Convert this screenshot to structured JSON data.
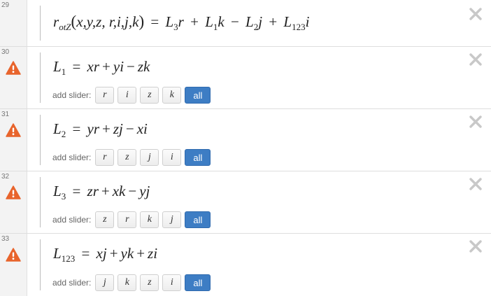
{
  "expressions": [
    {
      "line": "29",
      "warning": false,
      "math": {
        "fn_base": "r",
        "fn_sub": "otZ",
        "fn_args": "x,y,z, r,i,j,k",
        "t1": "L",
        "t1_sub": "3",
        "t1_var": "r",
        "op1": "+",
        "t2": "L",
        "t2_sub": "1",
        "t2_var": "k",
        "op2": "−",
        "t3": "L",
        "t3_sub": "2",
        "t3_var": "j",
        "op3": "+",
        "t4": "L",
        "t4_sub": "123",
        "t4_var": "i"
      }
    },
    {
      "line": "30",
      "warning": true,
      "lhs": "L",
      "lhs_sub": "1",
      "terms": [
        "xr",
        "+",
        "yi",
        "−",
        "zk"
      ],
      "slider_label": "add slider:",
      "sliders": [
        "r",
        "i",
        "z",
        "k"
      ],
      "all_label": "all"
    },
    {
      "line": "31",
      "warning": true,
      "lhs": "L",
      "lhs_sub": "2",
      "terms": [
        "yr",
        "+",
        "zj",
        "−",
        "xi"
      ],
      "slider_label": "add slider:",
      "sliders": [
        "r",
        "z",
        "j",
        "i"
      ],
      "all_label": "all"
    },
    {
      "line": "32",
      "warning": true,
      "lhs": "L",
      "lhs_sub": "3",
      "terms": [
        "zr",
        "+",
        "xk",
        "−",
        "yj"
      ],
      "slider_label": "add slider:",
      "sliders": [
        "z",
        "r",
        "k",
        "j"
      ],
      "all_label": "all"
    },
    {
      "line": "33",
      "warning": true,
      "lhs": "L",
      "lhs_sub": "123",
      "terms": [
        "xj",
        "+",
        "yk",
        "+",
        "zi"
      ],
      "slider_label": "add slider:",
      "sliders": [
        "j",
        "k",
        "z",
        "i"
      ],
      "all_label": "all"
    }
  ],
  "icons": {
    "warning": "warning-triangle-icon",
    "delete": "close-icon"
  },
  "colors": {
    "warning": "#e8642c",
    "all_button": "#3d7dc4",
    "delete_icon": "#c8c8c8",
    "gutter": "#f3f3f3"
  }
}
